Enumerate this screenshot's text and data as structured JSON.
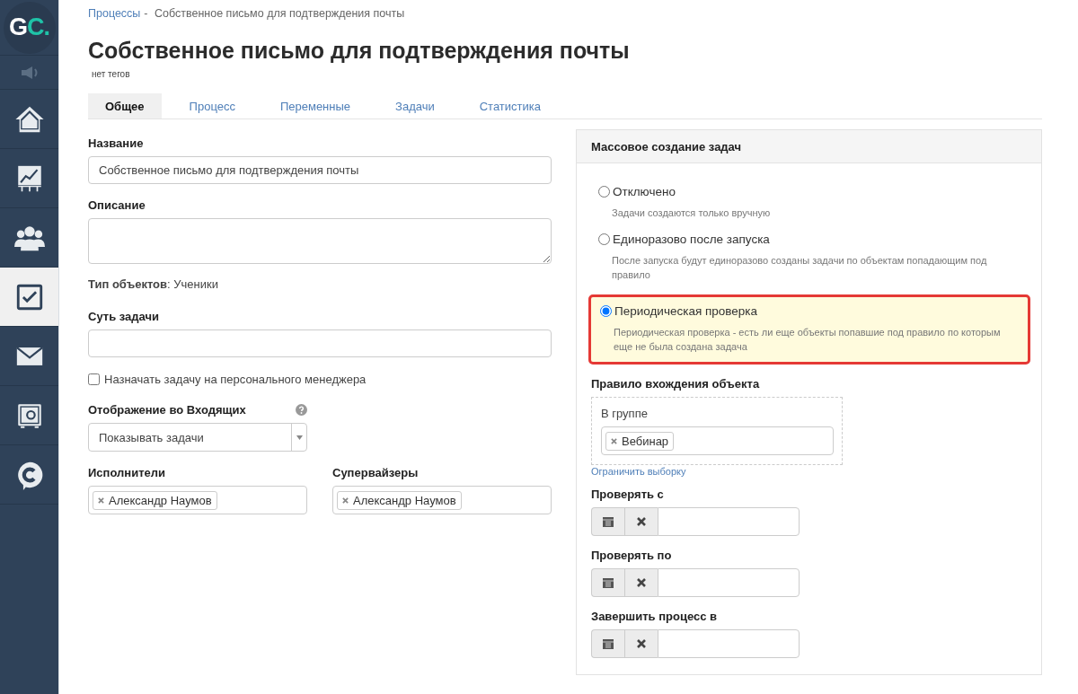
{
  "sidebar": {
    "logo": {
      "first": "G",
      "second": "C."
    },
    "items": [
      {
        "selected": false
      },
      {
        "selected": false
      },
      {
        "selected": false
      },
      {
        "selected": false
      },
      {
        "selected": true
      },
      {
        "selected": false
      },
      {
        "selected": false
      },
      {
        "selected": false
      }
    ]
  },
  "breadcrumb": {
    "link": "Процессы",
    "separator": "-",
    "current": "Собственное письмо для подтверждения почты"
  },
  "title": "Собственное письмо для подтверждения почты",
  "tags_text": "нет тегов",
  "tabs": [
    {
      "label": "Общее",
      "selected": true
    },
    {
      "label": "Процесс",
      "selected": false
    },
    {
      "label": "Переменные",
      "selected": false
    },
    {
      "label": "Задачи",
      "selected": false
    },
    {
      "label": "Статистика",
      "selected": false
    }
  ],
  "form": {
    "name": {
      "label": "Название",
      "value": "Собственное письмо для подтверждения почты"
    },
    "description": {
      "label": "Описание"
    },
    "object_type": "**Тип объектов**: Ученики",
    "task_essence": {
      "label": "Суть задачи"
    },
    "assign_manager": {
      "label": "Назначать задачу на персонального менеджера",
      "checked": false
    },
    "inbox_display": {
      "label": "Отображение во Входящих",
      "value": "Показывать задачи"
    },
    "executors": {
      "label": "Исполнители",
      "tags": [
        "Александр Наумов"
      ]
    },
    "supervisors": {
      "label": "Супервайзеры",
      "tags": [
        "Александр Наумов"
      ]
    }
  },
  "mass_creation": {
    "title": "Массовое создание задач",
    "options": [
      {
        "label": "Отключено",
        "hint": "Задачи создаются только вручную",
        "selected": false
      },
      {
        "label": "Единоразово после запуска",
        "hint": "После запуска будут единоразово созданы задачи по объектам попадающим под правило",
        "selected": false
      },
      {
        "label": "Периодическая проверка",
        "hint": "Периодическая проверка - есть ли еще объекты попавшие под правило по которым еще не была создана задача",
        "selected": true
      }
    ],
    "rule": {
      "label": "Правило вхождения объекта",
      "condition": "В группе",
      "tags": [
        "Вебинар"
      ],
      "link": "Ограничить выборку"
    },
    "dates": [
      {
        "label": "Проверять с"
      },
      {
        "label": "Проверять по"
      },
      {
        "label": "Завершить процесс в"
      }
    ]
  }
}
